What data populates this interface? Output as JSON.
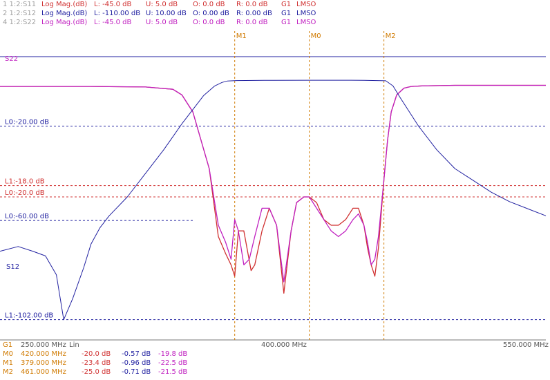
{
  "header": {
    "traces": [
      {
        "id": "1 1:2:S11",
        "format": "Log Mag.(dB)",
        "L": "L: -45.0 dB",
        "U": "U:  5.0 dB",
        "O": "O:  0.0 dB",
        "R": "R:  0.0 dB",
        "group": "G1",
        "mode": "LMSO",
        "color": "#d03030"
      },
      {
        "id": "2 1:2:S12",
        "format": "Log Mag.(dB)",
        "L": "L: -110.00 dB",
        "U": "U: 10.00 dB",
        "O": "O:  0.00 dB",
        "R": "R:  0.00 dB",
        "group": "G1",
        "mode": "LMSO",
        "color": "#2020a0"
      },
      {
        "id": "4 1:2:S22",
        "format": "Log Mag.(dB)",
        "L": "L: -45.0 dB",
        "U": "U:  5.0 dB",
        "O": "O:  0.0 dB",
        "R": "R:  0.0 dB",
        "group": "G1",
        "mode": "LMSO",
        "color": "#c020c0"
      }
    ]
  },
  "footer": {
    "sweep": {
      "group": "G1",
      "start": "250.000 MHz",
      "scale": "Lin",
      "center": "400.000 MHz",
      "stop": "550.000 MHz"
    },
    "markers": [
      {
        "name": "M0",
        "freq": "420.000 MHz",
        "s11": "-20.0  dB",
        "s12": "-0.57  dB",
        "s22": "-19.8  dB"
      },
      {
        "name": "M1",
        "freq": "379.000 MHz",
        "s11": "-23.4  dB",
        "s12": "-0.96  dB",
        "s22": "-22.5  dB"
      },
      {
        "name": "M2",
        "freq": "461.000 MHz",
        "s11": "-25.0  dB",
        "s12": "-0.71  dB",
        "s22": "-21.5  dB"
      }
    ]
  },
  "colors": {
    "s11": "#d03030",
    "s12": "#2020a0",
    "s22": "#c020c0",
    "marker": "#d07a00",
    "background": "#ffffff"
  },
  "chart_data": {
    "type": "line",
    "x_unit": "MHz",
    "xlim": [
      250,
      550
    ],
    "scales": {
      "S11": {
        "min": -45,
        "max": 5
      },
      "S12": {
        "min": -110,
        "max": 10
      },
      "S22": {
        "min": -45,
        "max": 5
      }
    },
    "trace_tags": {
      "S11": "S11",
      "S12": "S12",
      "S22": "S22"
    },
    "reference_lines": [
      {
        "label": "L0:-20.00 dB",
        "trace": "S12",
        "value": -20,
        "x_end": 550,
        "color": "#2020a0"
      },
      {
        "label": "L1:-18.0 dB",
        "trace": "S11",
        "value": -18,
        "x_end": 550,
        "color": "#d03030"
      },
      {
        "label": "L0:-20.0 dB",
        "trace": "S11",
        "value": -20,
        "x_end": 550,
        "color": "#d03030"
      },
      {
        "label": "L0:-60.00 dB",
        "trace": "S12",
        "value": -60,
        "x_end": 357,
        "color": "#2020a0"
      },
      {
        "label": "L1:-102.00 dB",
        "trace": "S12",
        "value": -102,
        "x_end": 550,
        "color": "#2020a0"
      }
    ],
    "markers": [
      {
        "label": "M1",
        "x": 379
      },
      {
        "label": "M0",
        "x": 420
      },
      {
        "label": "M2",
        "x": 461
      }
    ],
    "series": [
      {
        "name": "S11",
        "scale": "S11",
        "color": "#d03030",
        "x": [
          250,
          300,
          330,
          345,
          350,
          356,
          365,
          370,
          374,
          377,
          379,
          381,
          384,
          388,
          390,
          394,
          398,
          402,
          406,
          410,
          413,
          417,
          420,
          424,
          428,
          432,
          436,
          440,
          444,
          447,
          450,
          452,
          454,
          456,
          458,
          461,
          463,
          465,
          468,
          472,
          476,
          482,
          500,
          550
        ],
        "y": [
          -0.5,
          -0.5,
          -0.6,
          -1,
          -2,
          -5,
          -15,
          -27,
          -30,
          -32,
          -34,
          -26,
          -26,
          -33,
          -32,
          -26,
          -22,
          -25,
          -37,
          -26,
          -21,
          -20,
          -20,
          -21,
          -24,
          -25,
          -25,
          -24,
          -22,
          -22,
          -25,
          -29,
          -32,
          -34,
          -29,
          -17,
          -10,
          -5,
          -2,
          -0.8,
          -0.5,
          -0.4,
          -0.3,
          -0.3
        ]
      },
      {
        "name": "S22",
        "scale": "S22",
        "color": "#c020c0",
        "x": [
          250,
          300,
          330,
          345,
          350,
          356,
          365,
          370,
          374,
          377,
          379,
          381,
          384,
          387,
          390,
          394,
          398,
          402,
          406,
          410,
          413,
          417,
          420,
          424,
          428,
          432,
          436,
          440,
          444,
          447,
          450,
          452,
          454,
          456,
          458,
          461,
          463,
          465,
          468,
          472,
          476,
          482,
          500,
          550
        ],
        "y": [
          -0.5,
          -0.5,
          -0.6,
          -1,
          -2,
          -5,
          -15,
          -25,
          -28,
          -31,
          -24,
          -26,
          -32,
          -31,
          -27,
          -22,
          -22,
          -25,
          -35,
          -26,
          -21,
          -20,
          -20,
          -22,
          -24,
          -26,
          -27,
          -26,
          -24,
          -23,
          -25,
          -28,
          -32,
          -31,
          -27,
          -17,
          -10,
          -5,
          -2,
          -0.8,
          -0.5,
          -0.4,
          -0.3,
          -0.3
        ]
      },
      {
        "name": "S12",
        "scale": "S12",
        "color": "#2020a0",
        "x": [
          250,
          260,
          268,
          275,
          281,
          285,
          290,
          296,
          300,
          305,
          310,
          320,
          330,
          340,
          350,
          356,
          362,
          368,
          372,
          375,
          380,
          400,
          420,
          450,
          462,
          466,
          470,
          475,
          480,
          490,
          500,
          510,
          520,
          530,
          540,
          550
        ],
        "y": [
          -73,
          -71,
          -73,
          -75,
          -83,
          -102,
          -93,
          -80,
          -70,
          -63,
          -58,
          -50,
          -40,
          -30,
          -19,
          -13,
          -7,
          -3,
          -1.5,
          -0.9,
          -0.7,
          -0.6,
          -0.57,
          -0.6,
          -0.8,
          -3,
          -8,
          -14,
          -20,
          -30,
          -38,
          -43,
          -48,
          -52,
          -55,
          -58
        ]
      }
    ]
  }
}
